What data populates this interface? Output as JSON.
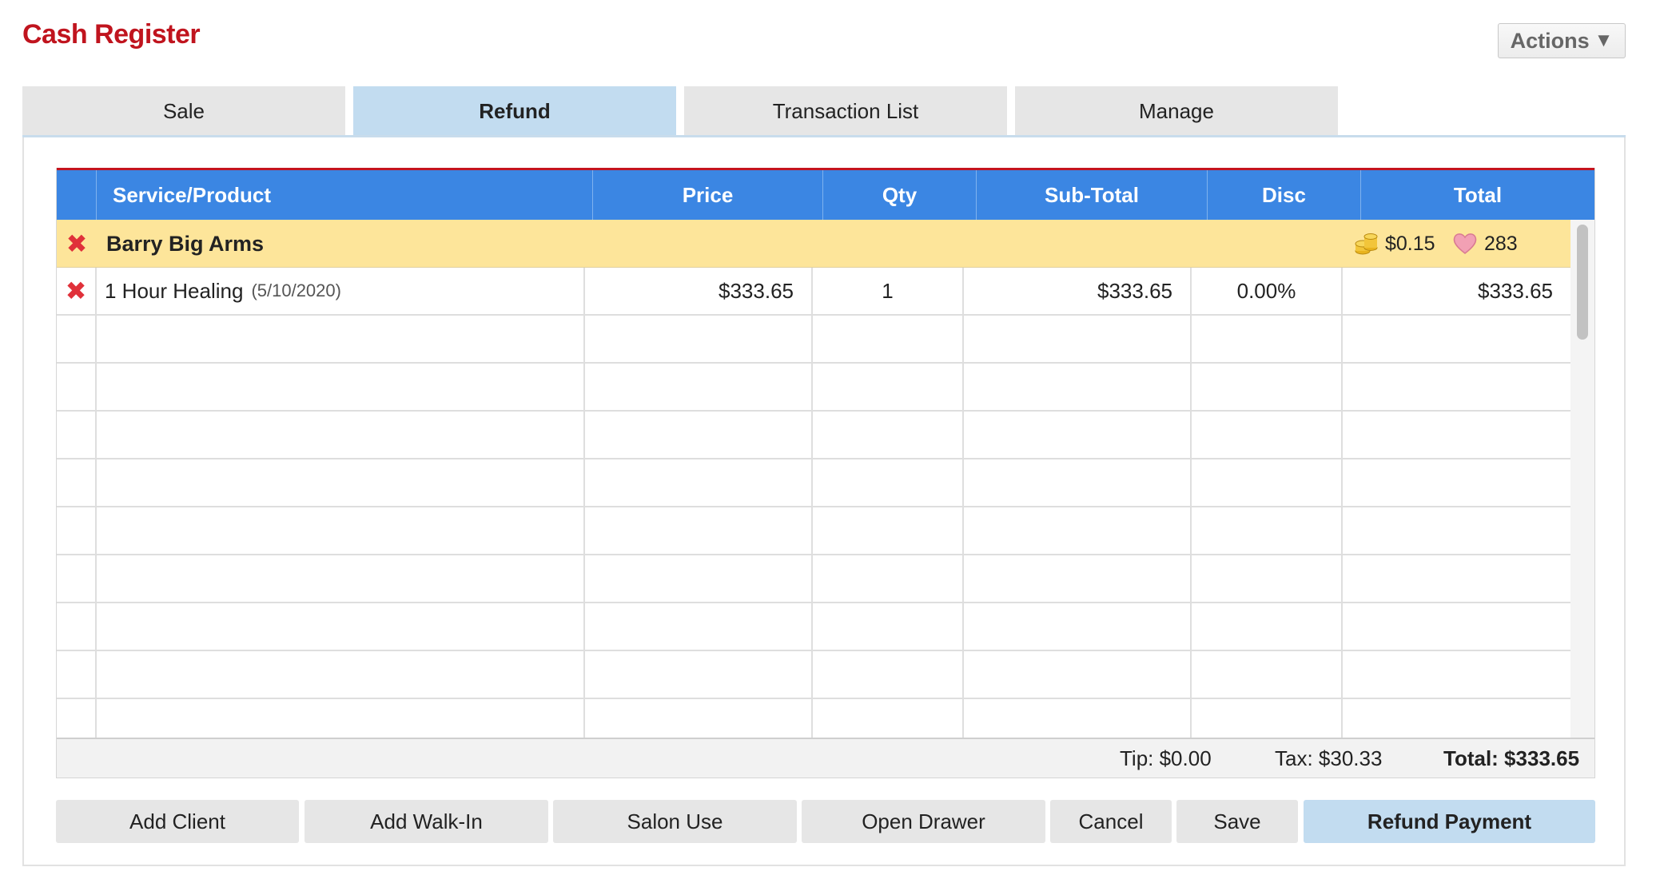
{
  "page": {
    "title": "Cash Register"
  },
  "actions": {
    "label": "Actions"
  },
  "tabs": [
    "Sale",
    "Refund",
    "Transaction List",
    "Manage"
  ],
  "active_tab": "Refund",
  "grid": {
    "columns": [
      "Service/Product",
      "Price",
      "Qty",
      "Sub-Total",
      "Disc",
      "Total"
    ],
    "client": {
      "name": "Barry Big Arms",
      "credit": "$0.15",
      "loyalty_points": "283"
    },
    "items": [
      {
        "name": "1 Hour Healing",
        "date": "(5/10/2020)",
        "price": "$333.65",
        "qty": "1",
        "subtotal": "$333.65",
        "disc": "0.00%",
        "total": "$333.65"
      }
    ]
  },
  "summary": {
    "tip": "Tip: $0.00",
    "tax": "Tax: $30.33",
    "total": "Total: $333.65"
  },
  "buttons": {
    "add_client": "Add Client",
    "add_walk_in": "Add Walk-In",
    "salon_use": "Salon Use",
    "open_drawer": "Open Drawer",
    "cancel": "Cancel",
    "save": "Save",
    "refund_payment": "Refund Payment"
  },
  "icons": {
    "remove": "remove-x-icon",
    "credit": "coins-icon",
    "loyalty": "heart-icon",
    "dropdown": "triangle-down-icon"
  },
  "colors": {
    "title": "#c0141e",
    "header": "#3b86e3",
    "client_row": "#fde59a",
    "active_tab": "#c2dcf0",
    "remove_icon": "#e0313a"
  }
}
